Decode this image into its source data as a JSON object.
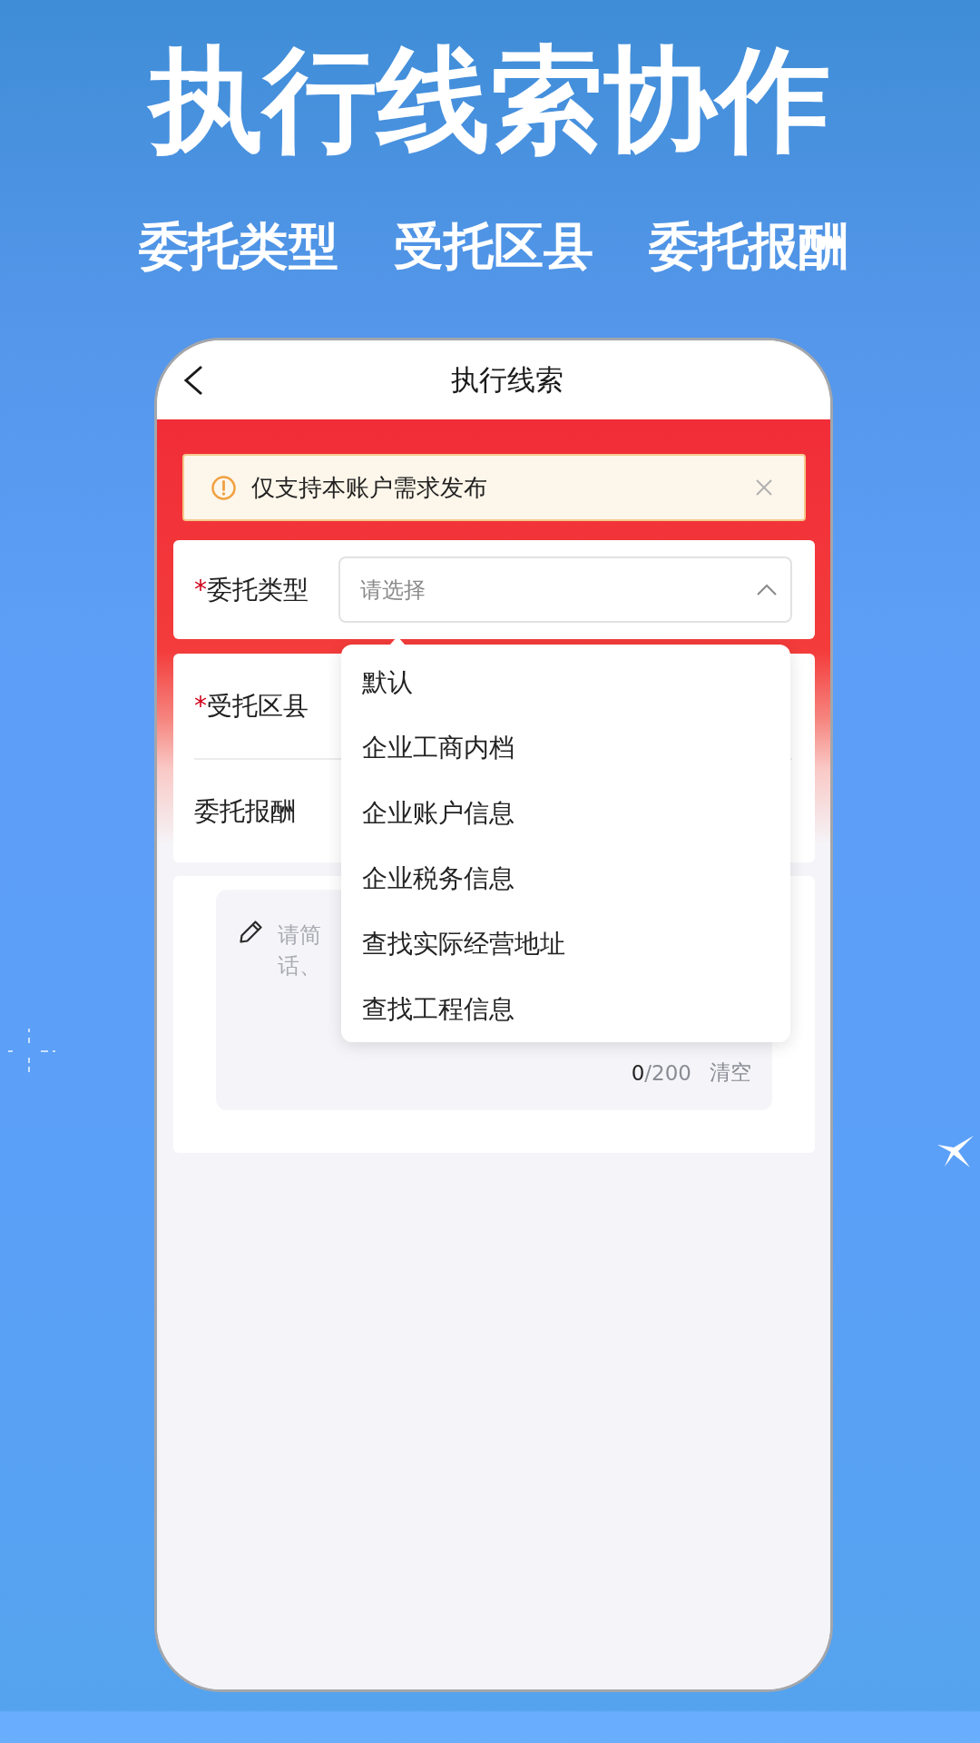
{
  "headline": "执行线索协作",
  "features": [
    "委托类型",
    "受托区县",
    "委托报酬"
  ],
  "phone": {
    "nav_bar": {
      "title": "执行线索"
    },
    "notice": {
      "text": "仅支持本账户需求发布"
    },
    "cards": [
      {
        "fields": [
          {
            "kind": "select",
            "required_mark": "*",
            "label": "委托类型",
            "placeholder": "请选择",
            "expanded": true,
            "options": [
              {
                "label": "默认",
                "selected": false
              },
              {
                "label": "企业工商内档",
                "selected": false
              },
              {
                "label": "企业账户信息",
                "selected": false
              },
              {
                "label": "企业税务信息",
                "selected": false
              },
              {
                "label": "查找实际经营地址",
                "selected": false
              },
              {
                "label": "查找工程信息",
                "selected": false
              }
            ]
          }
        ]
      },
      {
        "fields": [
          {
            "kind": "label",
            "required_mark": "*",
            "label": "受托区县"
          },
          {
            "kind": "label",
            "label": "委托报酬"
          }
        ]
      }
    ],
    "description": {
      "placeholder_lines": [
        "请简",
        "话、"
      ],
      "count": "0",
      "limit": "/200",
      "clear_button": "清空"
    }
  }
}
